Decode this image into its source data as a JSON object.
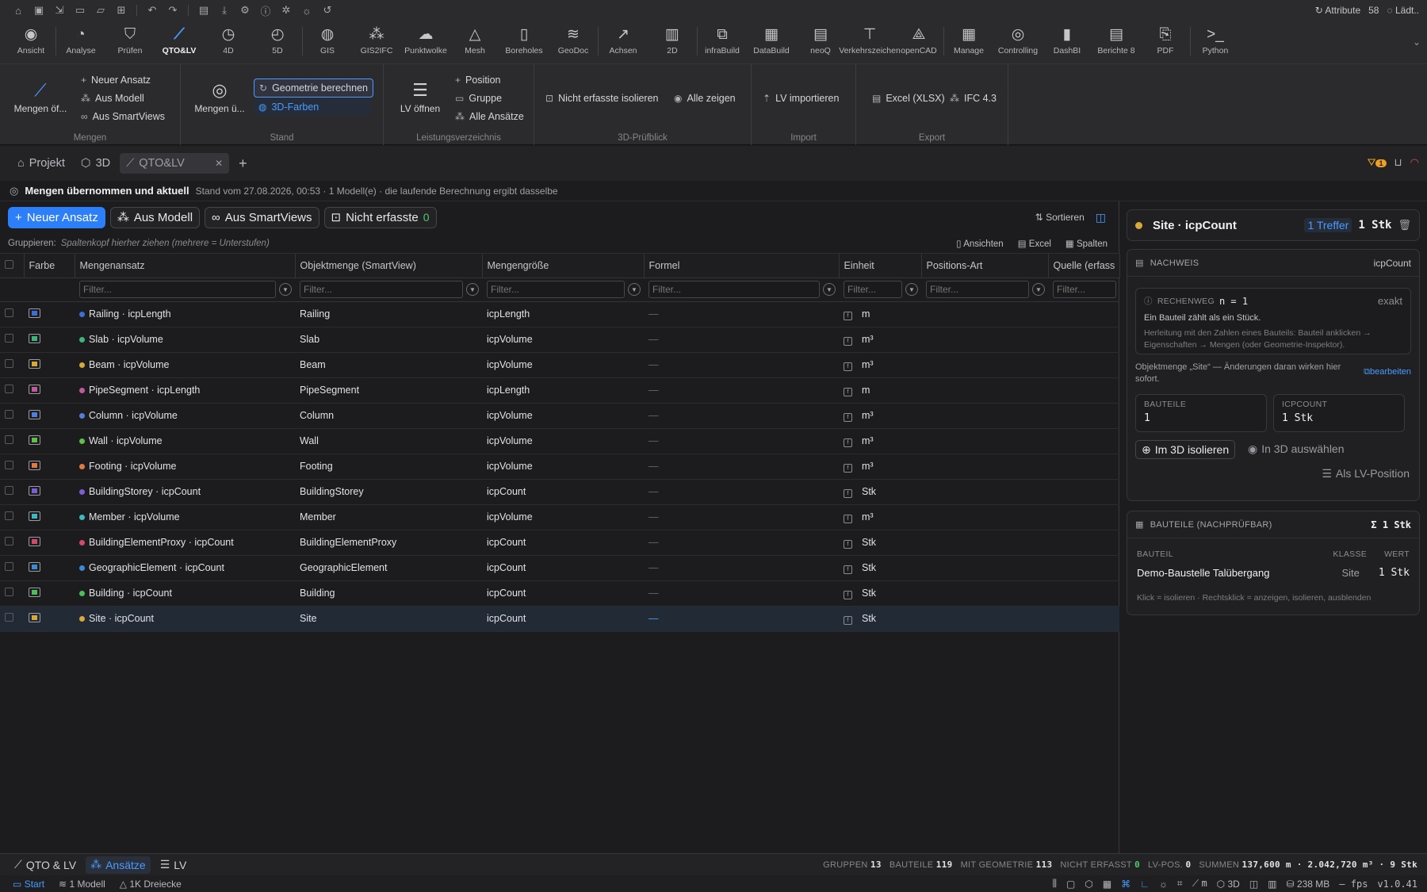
{
  "quickbar": {
    "icons": [
      "home-icon",
      "save-icon",
      "import-icon",
      "folder-icon",
      "folder-open-icon",
      "folder-add-icon",
      "undo-icon",
      "redo-icon",
      "window-icon",
      "download-icon",
      "settings-icon",
      "info-icon",
      "bug-icon",
      "sun-icon",
      "reset-icon"
    ],
    "attribute_label": "Attribute",
    "attribute_count": "58",
    "loading_label": "Lädt.."
  },
  "ribbon": {
    "tabs": [
      {
        "label": "Ansicht",
        "icon": "◉"
      },
      {
        "label": "Analyse",
        "icon": "◔"
      },
      {
        "label": "Prüfen",
        "icon": "⛉"
      },
      {
        "label": "QTO&LV",
        "icon": "⟋"
      },
      {
        "label": "4D",
        "icon": "◷"
      },
      {
        "label": "5D",
        "icon": "◴"
      },
      {
        "label": "GIS",
        "icon": "◍"
      },
      {
        "label": "GIS2IFC",
        "icon": "⁂"
      },
      {
        "label": "Punktwolke",
        "icon": "☁"
      },
      {
        "label": "Mesh",
        "icon": "△"
      },
      {
        "label": "Boreholes",
        "icon": "▯"
      },
      {
        "label": "GeoDoc",
        "icon": "≋"
      },
      {
        "label": "Achsen",
        "icon": "↗"
      },
      {
        "label": "2D",
        "icon": "▥"
      },
      {
        "label": "infraBuild",
        "icon": "⧉"
      },
      {
        "label": "DataBuild",
        "icon": "▦"
      },
      {
        "label": "neoQ",
        "icon": "▤"
      },
      {
        "label": "Verkehrszeichen",
        "icon": "⊤"
      },
      {
        "label": "openCAD",
        "icon": "⟁"
      },
      {
        "label": "Manage",
        "icon": "▦"
      },
      {
        "label": "Controlling",
        "icon": "◎"
      },
      {
        "label": "DashBI",
        "icon": "▮"
      },
      {
        "label": "Berichte 8",
        "icon": "▤"
      },
      {
        "label": "PDF",
        "icon": "⎘"
      },
      {
        "label": "Python",
        "icon": ">_"
      }
    ],
    "active": "QTO&LV"
  },
  "subribbon": {
    "mengen": {
      "label": "Mengen",
      "big": "Mengen öf...",
      "items": [
        "Neuer Ansatz",
        "Aus Modell",
        "Aus SmartViews"
      ]
    },
    "stand": {
      "label": "Stand",
      "big": "Mengen ü...",
      "items": [
        "Geometrie berechnen",
        "3D-Farben"
      ]
    },
    "lv": {
      "label": "Leistungsverzeichnis",
      "big": "LV öffnen",
      "items": [
        "Position",
        "Gruppe",
        "Alle Ansätze"
      ]
    },
    "pruefblick": {
      "label": "3D-Prüfblick",
      "items": [
        "Nicht erfasste isolieren",
        "Alle zeigen"
      ]
    },
    "import": {
      "label": "Import",
      "items": [
        "LV importieren"
      ]
    },
    "export": {
      "label": "Export",
      "items": [
        "Excel (XLSX)",
        "IFC 4.3"
      ]
    }
  },
  "doctabs": {
    "items": [
      "Projekt",
      "3D",
      "QTO&LV"
    ],
    "badge": "1"
  },
  "status": {
    "title": "Mengen übernommen und aktuell",
    "detail": "Stand vom 27.08.2026, 00:53 · 1 Modell(e) · die laufende Berechnung ergibt dasselbe"
  },
  "actionbar": {
    "new": "Neuer Ansatz",
    "from_model": "Aus Modell",
    "from_smartviews": "Aus SmartViews",
    "unrecorded": "Nicht erfasste",
    "unrecorded_count": "0",
    "sort": "Sortieren"
  },
  "grouping": {
    "label": "Gruppieren:",
    "hint": "Spaltenkopf hierher ziehen (mehrere = Unterstufen)",
    "views": "Ansichten",
    "excel": "Excel",
    "columns": "Spalten"
  },
  "table": {
    "headers": [
      "Farbe",
      "Mengenansatz",
      "Objektmenge (SmartView)",
      "Mengengröße",
      "Formel",
      "Einheit",
      "Positions-Art",
      "Quelle (erfass"
    ],
    "filter_placeholder": "Filter...",
    "rows": [
      {
        "color": "#3b6fd8",
        "name": "Railing · icpLength",
        "object": "Railing",
        "size": "icpLength",
        "formula": "—",
        "unit": "m"
      },
      {
        "color": "#3fb37a",
        "name": "Slab · icpVolume",
        "object": "Slab",
        "size": "icpVolume",
        "formula": "—",
        "unit": "m³"
      },
      {
        "color": "#d6a93a",
        "name": "Beam · icpVolume",
        "object": "Beam",
        "size": "icpVolume",
        "formula": "—",
        "unit": "m³"
      },
      {
        "color": "#c05a9a",
        "name": "PipeSegment · icpLength",
        "object": "PipeSegment",
        "size": "icpLength",
        "formula": "—",
        "unit": "m"
      },
      {
        "color": "#4f7fd6",
        "name": "Column · icpVolume",
        "object": "Column",
        "size": "icpVolume",
        "formula": "—",
        "unit": "m³"
      },
      {
        "color": "#5fbf4a",
        "name": "Wall · icpVolume",
        "object": "Wall",
        "size": "icpVolume",
        "formula": "—",
        "unit": "m³"
      },
      {
        "color": "#e07a45",
        "name": "Footing · icpVolume",
        "object": "Footing",
        "size": "icpVolume",
        "formula": "—",
        "unit": "m³"
      },
      {
        "color": "#7a5fd0",
        "name": "BuildingStorey · icpCount",
        "object": "BuildingStorey",
        "size": "icpCount",
        "formula": "—",
        "unit": "Stk"
      },
      {
        "color": "#3fb7c0",
        "name": "Member · icpVolume",
        "object": "Member",
        "size": "icpVolume",
        "formula": "—",
        "unit": "m³"
      },
      {
        "color": "#d04a6a",
        "name": "BuildingElementProxy · icpCount",
        "object": "BuildingElementProxy",
        "size": "icpCount",
        "formula": "—",
        "unit": "Stk"
      },
      {
        "color": "#3a8ad6",
        "name": "GeographicElement · icpCount",
        "object": "GeographicElement",
        "size": "icpCount",
        "formula": "—",
        "unit": "Stk"
      },
      {
        "color": "#4cbf5a",
        "name": "Building · icpCount",
        "object": "Building",
        "size": "icpCount",
        "formula": "—",
        "unit": "Stk"
      },
      {
        "color": "#d6a93a",
        "name": "Site · icpCount",
        "object": "Site",
        "size": "icpCount",
        "formula": "—",
        "unit": "Stk"
      }
    ]
  },
  "detail": {
    "title": "Site · icpCount",
    "hits": "1 Treffer",
    "total": "1 Stk",
    "nachweis": {
      "label": "NACHWEIS",
      "right": "icpCount",
      "rechenweg": "RECHENWEG",
      "formula": "n = 1",
      "exact": "exakt",
      "line1": "Ein Bauteil zählt als ein Stück.",
      "line2": "Herleitung mit den Zahlen eines Bauteils: Bauteil anklicken → Eigenschaften → Mengen (oder Geometrie-Inspektor).",
      "note": "Objektmenge „Site“ — Änderungen daran wirken hier sofort.",
      "edit": "bearbeiten",
      "bauteile_label": "BAUTEILE",
      "bauteile_value": "1",
      "icpcount_label": "ICPCOUNT",
      "icpcount_value": "1 Stk",
      "isolate": "Im 3D isolieren",
      "select": "In 3D auswählen",
      "as_lv": "Als LV-Position"
    },
    "bauteile": {
      "label": "BAUTEILE (NACHPRÜFBAR)",
      "sum": "Σ 1 Stk",
      "col_bauteil": "BAUTEIL",
      "col_klasse": "KLASSE",
      "col_wert": "WERT",
      "row_name": "Demo-Baustelle Talübergang",
      "row_class": "Site",
      "row_value": "1 Stk",
      "hint": "Klick = isolieren · Rechtsklick = anzeigen, isolieren, ausblenden"
    }
  },
  "bottombar": {
    "tabs": [
      "QTO & LV",
      "Ansätze",
      "LV"
    ],
    "stats": [
      {
        "label": "GRUPPEN",
        "value": "13"
      },
      {
        "label": "BAUTEILE",
        "value": "119"
      },
      {
        "label": "MIT GEOMETRIE",
        "value": "113"
      },
      {
        "label": "NICHT ERFASST",
        "value": "0"
      },
      {
        "label": "LV-POS.",
        "value": "0"
      },
      {
        "label": "SUMMEN",
        "value": "137,600 m · 2.042,720 m³ · 9 Stk"
      }
    ]
  },
  "statusbar": {
    "start": "Start",
    "model": "1 Modell",
    "triangles": "1K Dreiecke",
    "unit": "m",
    "view": "3D",
    "memory": "238 MB",
    "fps": "– fps",
    "version": "v1.0.41"
  }
}
